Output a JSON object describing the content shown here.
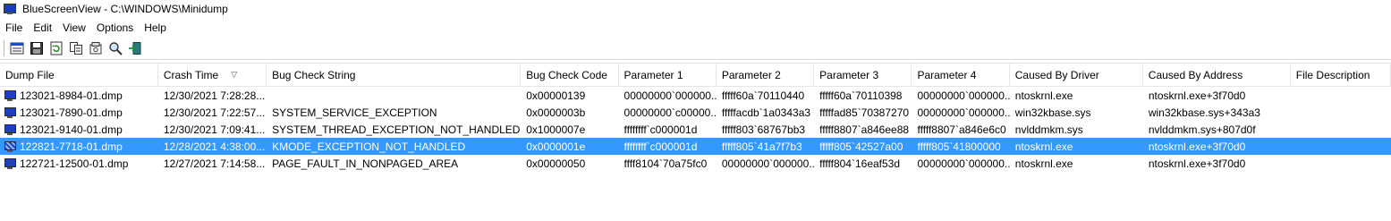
{
  "window": {
    "title": "BlueScreenView   -   C:\\WINDOWS\\Minidump"
  },
  "menu": [
    "File",
    "Edit",
    "View",
    "Options",
    "Help"
  ],
  "toolbar": {
    "buttons": [
      "properties-icon",
      "save-icon",
      "refresh-icon",
      "copy-icon",
      "properties-sheet-icon",
      "find-icon",
      "exit-icon"
    ]
  },
  "columns": [
    "Dump File",
    "Crash Time",
    "Bug Check String",
    "Bug Check Code",
    "Parameter 1",
    "Parameter 2",
    "Parameter 3",
    "Parameter 4",
    "Caused By Driver",
    "Caused By Address",
    "File Description"
  ],
  "sort_indicator": "▽",
  "rows": [
    [
      "123021-8984-01.dmp",
      "12/30/2021 7:28:28...",
      "",
      "0x00000139",
      "00000000`000000...",
      "fffff60a`70110440",
      "fffff60a`70110398",
      "00000000`000000...",
      "ntoskrnl.exe",
      "ntoskrnl.exe+3f70d0",
      ""
    ],
    [
      "123021-7890-01.dmp",
      "12/30/2021 7:22:57...",
      "SYSTEM_SERVICE_EXCEPTION",
      "0x0000003b",
      "00000000`c00000...",
      "fffffacdb`1a0343a3",
      "fffffad85`70387270",
      "00000000`000000...",
      "win32kbase.sys",
      "win32kbase.sys+343a3",
      ""
    ],
    [
      "123021-9140-01.dmp",
      "12/30/2021 7:09:41...",
      "SYSTEM_THREAD_EXCEPTION_NOT_HANDLED",
      "0x1000007e",
      "ffffffff`c000001d",
      "fffff803`68767bb3",
      "fffff8807`a846ee88",
      "fffff8807`a846e6c0",
      "nvlddmkm.sys",
      "nvlddmkm.sys+807d0f",
      ""
    ],
    [
      "122821-7718-01.dmp",
      "12/28/2021 4:38:00...",
      "KMODE_EXCEPTION_NOT_HANDLED",
      "0x0000001e",
      "ffffffff`c000001d",
      "fffff805`41a7f7b3",
      "fffff805`42527a00",
      "fffff805`41800000",
      "ntoskrnl.exe",
      "ntoskrnl.exe+3f70d0",
      ""
    ],
    [
      "122721-12500-01.dmp",
      "12/27/2021 7:14:58...",
      "PAGE_FAULT_IN_NONPAGED_AREA",
      "0x00000050",
      "ffff8104`70a75fc0",
      "00000000`000000...",
      "fffff804`16eaf53d",
      "00000000`000000...",
      "ntoskrnl.exe",
      "ntoskrnl.exe+3f70d0",
      ""
    ]
  ],
  "selected_row": 3
}
